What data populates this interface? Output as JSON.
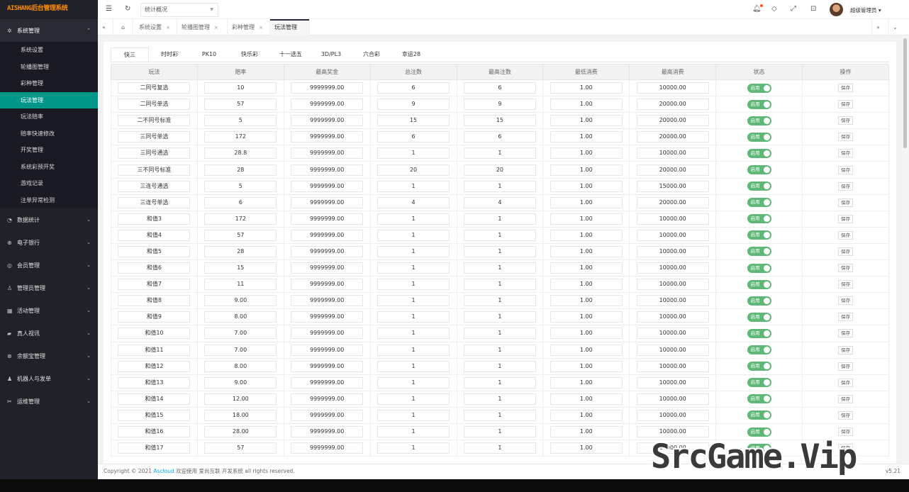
{
  "app": {
    "logo": "AISHANG后台管理系统"
  },
  "sidebar": {
    "groups": [
      {
        "label": "系统管理",
        "icon": "gear-icon",
        "expanded": true
      },
      {
        "label": "数据统计",
        "icon": "dashboard-icon"
      },
      {
        "label": "电子银行",
        "icon": "bank-icon"
      },
      {
        "label": "会员管理",
        "icon": "users-icon"
      },
      {
        "label": "管理员管理",
        "icon": "user-icon"
      },
      {
        "label": "活动管理",
        "icon": "calendar-icon"
      },
      {
        "label": "真人视讯",
        "icon": "group-icon"
      },
      {
        "label": "余额宝管理",
        "icon": "coin-icon"
      },
      {
        "label": "机器人与发单",
        "icon": "robot-icon"
      },
      {
        "label": "运维管理",
        "icon": "tools-icon"
      }
    ],
    "sub_items": [
      "系统设置",
      "轮播图管理",
      "彩种管理",
      "玩法管理",
      "玩法赔率",
      "赔率快速修改",
      "开奖管理",
      "系统彩预开奖",
      "游戏记录",
      "注单异常检测"
    ],
    "active_sub": "玩法管理"
  },
  "header": {
    "select_value": "统计概况",
    "user_name": "超级管理员"
  },
  "tabs": [
    {
      "label": "系统设置"
    },
    {
      "label": "轮播图管理"
    },
    {
      "label": "彩种管理"
    },
    {
      "label": "玩法管理",
      "active": true
    }
  ],
  "page_tabs": [
    "快三",
    "时时彩",
    "PK10",
    "快乐彩",
    "十一选五",
    "3D/PL3",
    "六合彩",
    "幸运28"
  ],
  "table": {
    "headers": [
      "玩法",
      "赔率",
      "最高奖金",
      "总注数",
      "最高注数",
      "最低消费",
      "最高消费",
      "状态",
      "操作"
    ],
    "status_label": "启用",
    "action_label": "保存",
    "rows": [
      [
        "二同号复选",
        "10",
        "9999999.00",
        "6",
        "6",
        "1.00",
        "10000.00"
      ],
      [
        "二同号单选",
        "57",
        "9999999.00",
        "9",
        "9",
        "1.00",
        "20000.00"
      ],
      [
        "二不同号标准",
        "5",
        "9999999.00",
        "15",
        "15",
        "1.00",
        "20000.00"
      ],
      [
        "三同号单选",
        "172",
        "9999999.00",
        "6",
        "6",
        "1.00",
        "20000.00"
      ],
      [
        "三同号通选",
        "28.8",
        "9999999.00",
        "1",
        "1",
        "1.00",
        "10000.00"
      ],
      [
        "三不同号标准",
        "28",
        "9999999.00",
        "20",
        "20",
        "1.00",
        "20000.00"
      ],
      [
        "三连号通选",
        "5",
        "9999999.00",
        "1",
        "1",
        "1.00",
        "15000.00"
      ],
      [
        "三连号单选",
        "6",
        "9999999.00",
        "4",
        "4",
        "1.00",
        "20000.00"
      ],
      [
        "和值3",
        "172",
        "9999999.00",
        "1",
        "1",
        "1.00",
        "10000.00"
      ],
      [
        "和值4",
        "57",
        "9999999.00",
        "1",
        "1",
        "1.00",
        "10000.00"
      ],
      [
        "和值5",
        "28",
        "9999999.00",
        "1",
        "1",
        "1.00",
        "10000.00"
      ],
      [
        "和值6",
        "15",
        "9999999.00",
        "1",
        "1",
        "1.00",
        "10000.00"
      ],
      [
        "和值7",
        "11",
        "9999999.00",
        "1",
        "1",
        "1.00",
        "10000.00"
      ],
      [
        "和值8",
        "9.00",
        "9999999.00",
        "1",
        "1",
        "1.00",
        "10000.00"
      ],
      [
        "和值9",
        "8.00",
        "9999999.00",
        "1",
        "1",
        "1.00",
        "10000.00"
      ],
      [
        "和值10",
        "7.00",
        "9999999.00",
        "1",
        "1",
        "1.00",
        "10000.00"
      ],
      [
        "和值11",
        "7.00",
        "9999999.00",
        "1",
        "1",
        "1.00",
        "10000.00"
      ],
      [
        "和值12",
        "8.00",
        "9999999.00",
        "1",
        "1",
        "1.00",
        "10000.00"
      ],
      [
        "和值13",
        "9.00",
        "9999999.00",
        "1",
        "1",
        "1.00",
        "10000.00"
      ],
      [
        "和值14",
        "12.00",
        "9999999.00",
        "1",
        "1",
        "1.00",
        "10000.00"
      ],
      [
        "和值15",
        "18.00",
        "9999999.00",
        "1",
        "1",
        "1.00",
        "10000.00"
      ],
      [
        "和值16",
        "28.00",
        "9999999.00",
        "1",
        "1",
        "1.00",
        "10000.00"
      ],
      [
        "和值17",
        "57",
        "9999999.00",
        "1",
        "1",
        "1.00",
        "10000.00"
      ]
    ]
  },
  "footer": {
    "prefix": "Copyright © 2021",
    "brand": "Ascloud",
    "suffix": "欢迎使用 爱尚互联 开发系统 all rights reserved.",
    "version": "v5.21"
  },
  "watermark": "SrcGame.Vip",
  "colors": {
    "sidebar_bg": "#20222a",
    "active_menu": "#009688",
    "switch_on": "#5fb878",
    "link": "#01aaed"
  }
}
